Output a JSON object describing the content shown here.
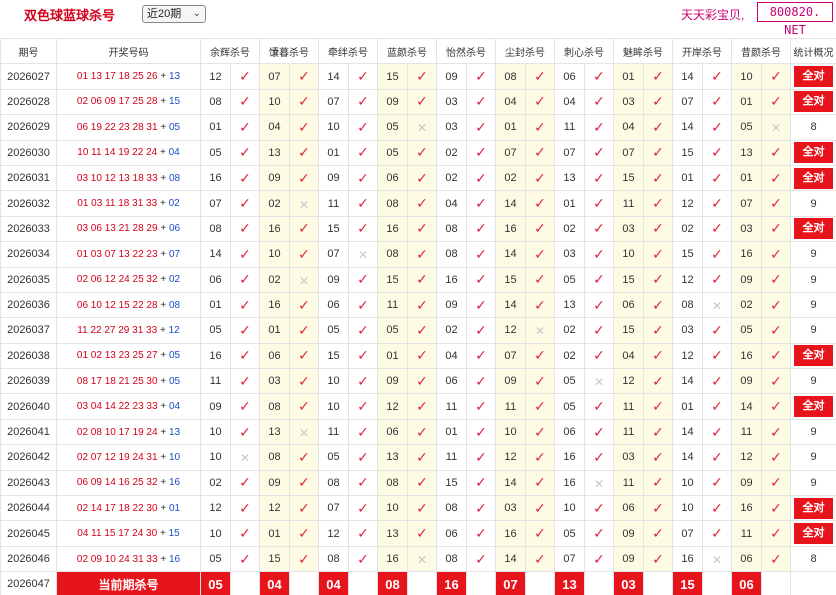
{
  "header": {
    "title": "双色球蓝球杀号",
    "period_select": "近20期",
    "brand_text": "天天彩宝贝,",
    "brand_url": "800820. NET"
  },
  "columns": {
    "issue": "期号",
    "draw": "开奖号码",
    "experts": [
      "余辉杀号",
      "馕暮杀号",
      "牵绊杀号",
      "蓝颜杀号",
      "怡然杀号",
      "尘封杀号",
      "刺心杀号",
      "魅眸杀号",
      "开岸杀号",
      "昔颜杀号"
    ],
    "stat": "统计概况"
  },
  "icons": {
    "hit": "check-icon",
    "miss": "cross-icon"
  },
  "colors": {
    "red": "#d4001a",
    "blue": "#1a4fc7",
    "badge": "#e8141c",
    "stripe": "#fefbe4"
  },
  "rows": [
    {
      "issue": "2026027",
      "red": "01 13 17 18 25 26",
      "blue": "13",
      "kills": [
        "12",
        "07",
        "14",
        "15",
        "09",
        "08",
        "06",
        "01",
        "14",
        "10"
      ],
      "marks": [
        1,
        1,
        1,
        1,
        1,
        1,
        1,
        1,
        1,
        1
      ],
      "stat": "全对"
    },
    {
      "issue": "2026028",
      "red": "02 06 09 17 25 28",
      "blue": "15",
      "kills": [
        "08",
        "10",
        "07",
        "09",
        "03",
        "04",
        "04",
        "03",
        "07",
        "01"
      ],
      "marks": [
        1,
        1,
        1,
        1,
        1,
        1,
        1,
        1,
        1,
        1
      ],
      "stat": "全对"
    },
    {
      "issue": "2026029",
      "red": "06 19 22 23 28 31",
      "blue": "05",
      "kills": [
        "01",
        "04",
        "10",
        "05",
        "03",
        "01",
        "11",
        "04",
        "14",
        "05"
      ],
      "marks": [
        1,
        1,
        1,
        0,
        1,
        1,
        1,
        1,
        1,
        0
      ],
      "stat": "8"
    },
    {
      "issue": "2026030",
      "red": "10 11 14 19 22 24",
      "blue": "04",
      "kills": [
        "05",
        "13",
        "01",
        "05",
        "02",
        "07",
        "07",
        "07",
        "15",
        "13"
      ],
      "marks": [
        1,
        1,
        1,
        1,
        1,
        1,
        1,
        1,
        1,
        1
      ],
      "stat": "全对"
    },
    {
      "issue": "2026031",
      "red": "03 10 12 13 18 33",
      "blue": "08",
      "kills": [
        "16",
        "09",
        "09",
        "06",
        "02",
        "02",
        "13",
        "15",
        "01",
        "01"
      ],
      "marks": [
        1,
        1,
        1,
        1,
        1,
        1,
        1,
        1,
        1,
        1
      ],
      "stat": "全对"
    },
    {
      "issue": "2026032",
      "red": "01 03 11 18 31 33",
      "blue": "02",
      "kills": [
        "07",
        "02",
        "11",
        "08",
        "04",
        "14",
        "01",
        "11",
        "12",
        "07"
      ],
      "marks": [
        1,
        0,
        1,
        1,
        1,
        1,
        1,
        1,
        1,
        1
      ],
      "stat": "9"
    },
    {
      "issue": "2026033",
      "red": "03 06 13 21 28 29",
      "blue": "06",
      "kills": [
        "08",
        "16",
        "15",
        "16",
        "08",
        "16",
        "02",
        "03",
        "02",
        "03"
      ],
      "marks": [
        1,
        1,
        1,
        1,
        1,
        1,
        1,
        1,
        1,
        1
      ],
      "stat": "全对"
    },
    {
      "issue": "2026034",
      "red": "01 03 07 13 22 23",
      "blue": "07",
      "kills": [
        "14",
        "10",
        "07",
        "08",
        "08",
        "14",
        "03",
        "10",
        "15",
        "16"
      ],
      "marks": [
        1,
        1,
        0,
        1,
        1,
        1,
        1,
        1,
        1,
        1
      ],
      "stat": "9"
    },
    {
      "issue": "2026035",
      "red": "02 06 12 24 25 32",
      "blue": "02",
      "kills": [
        "06",
        "02",
        "09",
        "15",
        "16",
        "15",
        "05",
        "15",
        "12",
        "09"
      ],
      "marks": [
        1,
        0,
        1,
        1,
        1,
        1,
        1,
        1,
        1,
        1
      ],
      "stat": "9"
    },
    {
      "issue": "2026036",
      "red": "06 10 12 15 22 28",
      "blue": "08",
      "kills": [
        "01",
        "16",
        "06",
        "11",
        "09",
        "14",
        "13",
        "06",
        "08",
        "02"
      ],
      "marks": [
        1,
        1,
        1,
        1,
        1,
        1,
        1,
        1,
        0,
        1
      ],
      "stat": "9"
    },
    {
      "issue": "2026037",
      "red": "11 22 27 29 31 33",
      "blue": "12",
      "kills": [
        "05",
        "01",
        "05",
        "05",
        "02",
        "12",
        "02",
        "15",
        "03",
        "05"
      ],
      "marks": [
        1,
        1,
        1,
        1,
        1,
        0,
        1,
        1,
        1,
        1
      ],
      "stat": "9"
    },
    {
      "issue": "2026038",
      "red": "01 02 13 23 25 27",
      "blue": "05",
      "kills": [
        "16",
        "06",
        "15",
        "01",
        "04",
        "07",
        "02",
        "04",
        "12",
        "16"
      ],
      "marks": [
        1,
        1,
        1,
        1,
        1,
        1,
        1,
        1,
        1,
        1
      ],
      "stat": "全对"
    },
    {
      "issue": "2026039",
      "red": "08 17 18 21 25 30",
      "blue": "05",
      "kills": [
        "11",
        "03",
        "10",
        "09",
        "06",
        "09",
        "05",
        "12",
        "14",
        "09"
      ],
      "marks": [
        1,
        1,
        1,
        1,
        1,
        1,
        0,
        1,
        1,
        1
      ],
      "stat": "9"
    },
    {
      "issue": "2026040",
      "red": "03 04 14 22 23 33",
      "blue": "04",
      "kills": [
        "09",
        "08",
        "10",
        "12",
        "11",
        "11",
        "05",
        "11",
        "01",
        "14"
      ],
      "marks": [
        1,
        1,
        1,
        1,
        1,
        1,
        1,
        1,
        1,
        1
      ],
      "stat": "全对"
    },
    {
      "issue": "2026041",
      "red": "02 08 10 17 19 24",
      "blue": "13",
      "kills": [
        "10",
        "13",
        "11",
        "06",
        "01",
        "10",
        "06",
        "11",
        "14",
        "11"
      ],
      "marks": [
        1,
        0,
        1,
        1,
        1,
        1,
        1,
        1,
        1,
        1
      ],
      "stat": "9"
    },
    {
      "issue": "2026042",
      "red": "02 07 12 19 24 31",
      "blue": "10",
      "kills": [
        "10",
        "08",
        "05",
        "13",
        "11",
        "12",
        "16",
        "03",
        "14",
        "12"
      ],
      "marks": [
        0,
        1,
        1,
        1,
        1,
        1,
        1,
        1,
        1,
        1
      ],
      "stat": "9"
    },
    {
      "issue": "2026043",
      "red": "06 09 14 16 25 32",
      "blue": "16",
      "kills": [
        "02",
        "09",
        "08",
        "08",
        "15",
        "14",
        "16",
        "11",
        "10",
        "09"
      ],
      "marks": [
        1,
        1,
        1,
        1,
        1,
        1,
        0,
        1,
        1,
        1
      ],
      "stat": "9"
    },
    {
      "issue": "2026044",
      "red": "02 14 17 18 22 30",
      "blue": "01",
      "kills": [
        "12",
        "12",
        "07",
        "10",
        "08",
        "03",
        "10",
        "06",
        "10",
        "16"
      ],
      "marks": [
        1,
        1,
        1,
        1,
        1,
        1,
        1,
        1,
        1,
        1
      ],
      "stat": "全对"
    },
    {
      "issue": "2026045",
      "red": "04 11 15 17 24 30",
      "blue": "15",
      "kills": [
        "10",
        "01",
        "12",
        "13",
        "06",
        "16",
        "05",
        "09",
        "07",
        "11"
      ],
      "marks": [
        1,
        1,
        1,
        1,
        1,
        1,
        1,
        1,
        1,
        1
      ],
      "stat": "全对"
    },
    {
      "issue": "2026046",
      "red": "02 09 10 24 31 33",
      "blue": "16",
      "kills": [
        "05",
        "15",
        "08",
        "16",
        "08",
        "14",
        "07",
        "09",
        "16",
        "06"
      ],
      "marks": [
        1,
        1,
        1,
        0,
        1,
        1,
        1,
        1,
        0,
        1
      ],
      "stat": "8"
    }
  ],
  "current": {
    "issue": "2026047",
    "label": "当前期杀号",
    "kills": [
      "05",
      "04",
      "04",
      "08",
      "16",
      "07",
      "13",
      "03",
      "15",
      "06"
    ]
  }
}
